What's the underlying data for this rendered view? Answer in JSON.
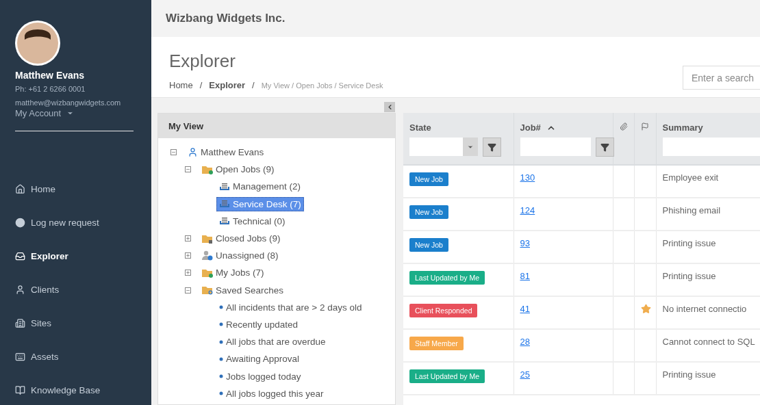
{
  "sidebar": {
    "user": {
      "name": "Matthew Evans",
      "phone": "Ph: +61 2 6266 0001",
      "email": "matthew@wizbangwidgets.com",
      "account_menu": "My Account"
    },
    "items": [
      {
        "label": "Home",
        "kind": "home",
        "selected": false
      },
      {
        "label": "Log new request",
        "kind": "circle",
        "selected": false
      },
      {
        "label": "Explorer",
        "kind": "tray",
        "selected": true
      },
      {
        "label": "Clients",
        "kind": "user",
        "selected": false
      },
      {
        "label": "Sites",
        "kind": "building",
        "selected": false
      },
      {
        "label": "Assets",
        "kind": "keyboard",
        "selected": false
      },
      {
        "label": "Knowledge Base",
        "kind": "book",
        "selected": false
      }
    ]
  },
  "header": {
    "company": "Wizbang Widgets Inc."
  },
  "page": {
    "title": "Explorer",
    "breadcrumb": [
      {
        "label": "Home",
        "kind": "link"
      },
      {
        "label": "/",
        "kind": "separator"
      },
      {
        "label": "Explorer",
        "kind": "current"
      },
      {
        "label": "/",
        "kind": "separator"
      }
    ],
    "path": "My View / Open Jobs / Service Desk",
    "search": {
      "placeholder": "Enter a search"
    }
  },
  "tree_panel": {
    "title": "My View",
    "tree": [
      {
        "label": "Matthew Evans",
        "kind": "user",
        "expanded": true,
        "selected": false,
        "children": [
          {
            "label": "Open Jobs (9)",
            "kind": "folder-open",
            "expanded": true,
            "selected": false,
            "children": [
              {
                "label": "Management (2)",
                "kind": "queue",
                "selected": false
              },
              {
                "label": "Service Desk (7)",
                "kind": "queue",
                "selected": true
              },
              {
                "label": "Technical (0)",
                "kind": "queue",
                "selected": false
              }
            ]
          },
          {
            "label": "Closed Jobs (9)",
            "kind": "folder-closed",
            "expanded": false,
            "selected": false
          },
          {
            "label": "Unassigned (8)",
            "kind": "unassigned",
            "expanded": false,
            "selected": false
          },
          {
            "label": "My Jobs (7)",
            "kind": "folder-open",
            "expanded": false,
            "selected": false
          },
          {
            "label": "Saved Searches",
            "kind": "folder-search",
            "expanded": true,
            "selected": false,
            "children": [
              {
                "label": "All incidents that are > 2 days old",
                "kind": "search",
                "selected": false
              },
              {
                "label": "Recently updated",
                "kind": "search",
                "selected": false
              },
              {
                "label": "All jobs that are overdue",
                "kind": "search",
                "selected": false
              },
              {
                "label": "Awaiting Approval",
                "kind": "search",
                "selected": false
              },
              {
                "label": "Jobs logged today",
                "kind": "search",
                "selected": false
              },
              {
                "label": "All jobs logged this year",
                "kind": "search",
                "selected": false
              }
            ]
          }
        ]
      }
    ]
  },
  "table": {
    "columns": [
      {
        "label": "State",
        "kind": "select",
        "sorted": false
      },
      {
        "label": "Job#",
        "kind": "input",
        "sorted": true
      },
      {
        "kind": "attachment"
      },
      {
        "kind": "flag"
      },
      {
        "label": "Summary",
        "kind": "text"
      }
    ],
    "rows": [
      {
        "state": "New Job",
        "color": "#1b7fcc",
        "job": "130",
        "flagged": false,
        "summary": "Employee exit"
      },
      {
        "state": "New Job",
        "color": "#1b7fcc",
        "job": "124",
        "flagged": false,
        "summary": "Phishing email"
      },
      {
        "state": "New Job",
        "color": "#1b7fcc",
        "job": "93",
        "flagged": false,
        "summary": "Printing issue"
      },
      {
        "state": "Last Updated by Me",
        "color": "#1aae88",
        "job": "81",
        "flagged": false,
        "summary": "Printing issue"
      },
      {
        "state": "Client Responded",
        "color": "#e8505b",
        "job": "41",
        "flagged": true,
        "summary": "No internet connectio"
      },
      {
        "state": "Staff Member",
        "color": "#f7a84a",
        "job": "28",
        "flagged": false,
        "summary": "Cannot connect to SQL"
      },
      {
        "state": "Last Updated by Me",
        "color": "#1aae88",
        "job": "25",
        "flagged": false,
        "summary": "Printing issue"
      }
    ]
  }
}
